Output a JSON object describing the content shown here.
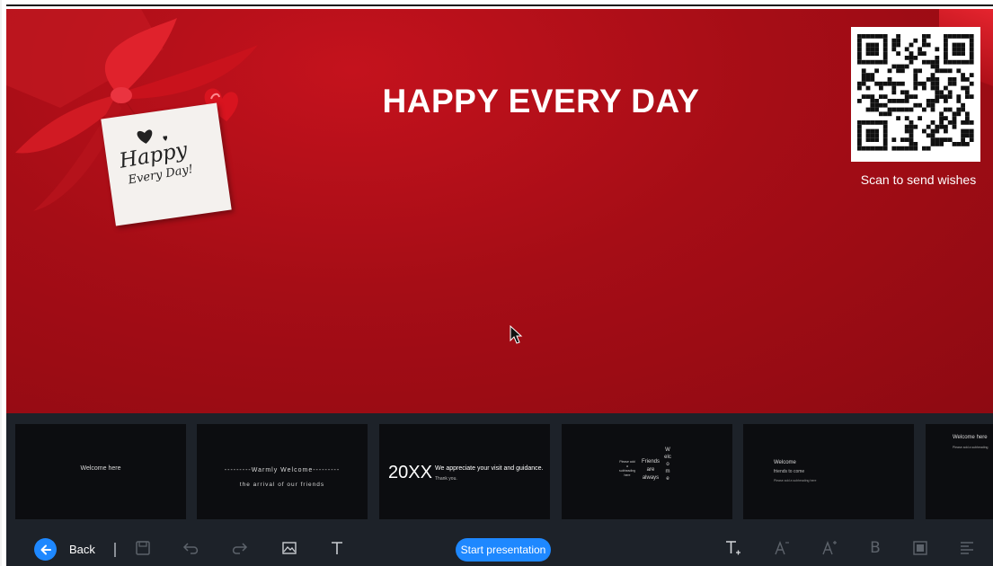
{
  "slide": {
    "title": "HAPPY EVERY DAY",
    "tag_line1": "Happy",
    "tag_line2": "Every Day!",
    "qr_caption": "Scan to send wishes"
  },
  "thumbnails": [
    {
      "lines": [
        "Welcome here"
      ]
    },
    {
      "lines": [
        "---------Warmly Welcome---------",
        "the arrival of our friends"
      ]
    },
    {
      "lines": [
        "20XX",
        "We appreciate your visit and guidance.",
        "Thank you."
      ]
    },
    {
      "lines": [
        "Please add a subheading here",
        "Friends are always",
        "Welcome"
      ]
    },
    {
      "lines": [
        "Welcome",
        "friends to come",
        "Please add a subheading here"
      ]
    },
    {
      "lines": [
        "Welcome here",
        "Please add a subheading"
      ]
    }
  ],
  "toolbar": {
    "back_label": "Back",
    "start_label": "Start presentation",
    "icons": [
      "back-arrow-icon",
      "save-icon",
      "undo-icon",
      "redo-icon",
      "image-icon",
      "text-icon",
      "text-add-icon",
      "font-decrease-icon",
      "font-increase-icon",
      "bold-icon",
      "color-fill-icon",
      "align-icon"
    ],
    "bold_glyph": "B"
  },
  "colors": {
    "slide_red": "#a60d16",
    "strip_bg": "#1d2229",
    "accent_blue": "#1e88ff"
  }
}
